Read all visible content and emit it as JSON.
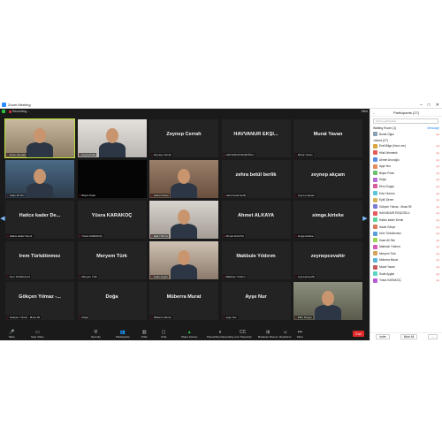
{
  "window": {
    "title": "Zoom Meeting",
    "recording_label": "Recording...",
    "view_label": "View",
    "minimize_glyph": "–",
    "maximize_glyph": "□",
    "close_glyph": "✕"
  },
  "grid": {
    "tiles": [
      {
        "name": "",
        "label": "Emre Altunatlı",
        "kind": "video",
        "active": true
      },
      {
        "name": "",
        "label": "Feyza Polat",
        "kind": "video"
      },
      {
        "name": "Zeynep Cerrah",
        "label": "Zeynep Cerrah"
      },
      {
        "name": "HAVVANUR EKŞİ...",
        "label": "HAVVANUR EKŞİOĞLU"
      },
      {
        "name": "Murat Yavan",
        "label": "Murat Yavan"
      },
      {
        "name": "",
        "label": "Kaan Ali Sim",
        "kind": "video"
      },
      {
        "name": "",
        "label": "Büşra Polat",
        "kind": "dark"
      },
      {
        "name": "",
        "label": "Hazal Gökçe",
        "kind": "video"
      },
      {
        "name": "zehra betül berlik",
        "label": "zehra betül berlik"
      },
      {
        "name": "zeynep akçam",
        "label": "zeynep akçam"
      },
      {
        "name": "Hatice kader De...",
        "label": "Hatice kader Demir"
      },
      {
        "name": "Yüsra KARAKOÇ",
        "label": "Yüsra KARAKOÇ"
      },
      {
        "name": "",
        "label": "Eda Yıldırım",
        "kind": "video"
      },
      {
        "name": "Ahmet ALKAYA",
        "label": "Ahmet ALKAYA"
      },
      {
        "name": "simge.kirteke",
        "label": "simge.kirteke"
      },
      {
        "name": "İrem Türkdönmez",
        "label": "İrem Türkdönmez"
      },
      {
        "name": "Meryem Türk",
        "label": "Meryem Türk"
      },
      {
        "name": "",
        "label": "Sude Aygün",
        "kind": "video"
      },
      {
        "name": "Makbule Yıldırım",
        "label": "Makbule Yıldırım"
      },
      {
        "name": "zeynepcevahir",
        "label": "zeynepcevahir"
      },
      {
        "name": "Gökçen Yılmaz -...",
        "label": "Gökçen Yılmaz - Mcas 99"
      },
      {
        "name": "Doğa",
        "label": "Doğa"
      },
      {
        "name": "Müberra Murat",
        "label": "Müberra Murat"
      },
      {
        "name": "Ayşe Nur",
        "label": "Ayşe Nur"
      },
      {
        "name": "",
        "label": "Ebru Duygu",
        "kind": "video"
      }
    ]
  },
  "toolbar": {
    "items": [
      {
        "label": "Mute",
        "icon": "🎤"
      },
      {
        "label": "Stop Video",
        "icon": "▭"
      },
      {
        "label": "Security",
        "icon": "⛨"
      },
      {
        "label": "Participants",
        "icon": "👥"
      },
      {
        "label": "Polls",
        "icon": "▥"
      },
      {
        "label": "Chat",
        "icon": "▢"
      },
      {
        "label": "Share Screen",
        "icon": "▲"
      },
      {
        "label": "Pause/Stop Recording",
        "icon": "⏸"
      },
      {
        "label": "Live Transcript",
        "icon": "CC"
      },
      {
        "label": "Breakout Rooms",
        "icon": "⊞"
      },
      {
        "label": "Reactions",
        "icon": "☺"
      },
      {
        "label": "More",
        "icon": "•••"
      }
    ],
    "end_label": "End"
  },
  "panel": {
    "title": "Participants (27)",
    "search_placeholder": "Find a participant",
    "waiting_label": "Waiting Room (1)",
    "waiting_action": "Message",
    "waiting": [
      {
        "name": "Burak Oğuz",
        "color": "#8aa0b4"
      }
    ],
    "joined_label": "Joined (27)",
    "participants": [
      {
        "name": "Emil Bilge (Host, me)",
        "color": "#d9a441"
      },
      {
        "name": "Hilal Ürkmelek",
        "color": "#e35b5b"
      },
      {
        "name": "Ahmet Arıcıoğlu",
        "color": "#5b8de3"
      },
      {
        "name": "Ayşe Nur",
        "color": "#e38a5b"
      },
      {
        "name": "Büşra Polat",
        "color": "#6bc26b"
      },
      {
        "name": "Doğa",
        "color": "#b56bd6"
      },
      {
        "name": "Ebru Duygu",
        "color": "#d65b9d"
      },
      {
        "name": "Eda Yıldırım",
        "color": "#5bc6d6"
      },
      {
        "name": "Eylül Şener",
        "color": "#d6b45b"
      },
      {
        "name": "Gökçen Yılmaz - Mcas 99",
        "color": "#7b7bd6"
      },
      {
        "name": "HAVVANUR EKŞİOĞLU",
        "color": "#e35b5b"
      },
      {
        "name": "Hatice kader Demir",
        "color": "#5bd69d"
      },
      {
        "name": "Hazal Gökçe",
        "color": "#d67b5b"
      },
      {
        "name": "İrem Türkdönmez",
        "color": "#5b9dd6"
      },
      {
        "name": "Kaan Ali Sim",
        "color": "#9dd65b"
      },
      {
        "name": "Makbule Yıldırım",
        "color": "#d65bb5"
      },
      {
        "name": "Meryem Türk",
        "color": "#d6a35b"
      },
      {
        "name": "Müberra Murat",
        "color": "#5bb5d6"
      },
      {
        "name": "Murat Yavan",
        "color": "#c65b5b"
      },
      {
        "name": "Sude Aygün",
        "color": "#5bd6c6"
      },
      {
        "name": "Yüsra KARAKOÇ",
        "color": "#b55bd6"
      }
    ],
    "invite_label": "Invite",
    "mute_all_label": "Mute All",
    "more_label": "..."
  }
}
